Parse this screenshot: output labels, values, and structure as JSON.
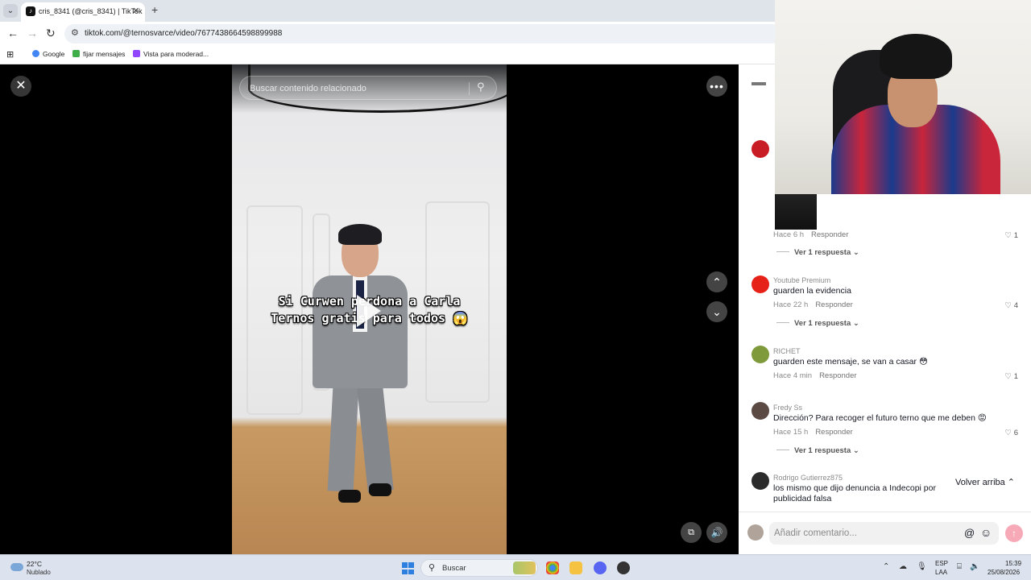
{
  "browser": {
    "tab_title": "cris_8341 (@cris_8341) | TikTok",
    "tab_close": "✕",
    "new_tab": "+",
    "url": "tiktok.com/@ternosvarce/video/7677438664598899988",
    "bookmarks": [
      {
        "label": "Google",
        "color": "#4285f4"
      },
      {
        "label": "fijar mensajes",
        "color": "#3fae49"
      },
      {
        "label": "Vista para moderad...",
        "color": "#9146ff"
      }
    ]
  },
  "video": {
    "search_placeholder": "Buscar contenido relacionado",
    "caption_line1": "Si Curwen perdona a Carla",
    "caption_line2": "Ternos gratis para todos 😱",
    "close_icon": "✕",
    "more_icon": "•••",
    "up_icon": "⌃",
    "down_icon": "⌄",
    "pip_icon": "⧉",
    "volume_icon": "🔊"
  },
  "comments": [
    {
      "user": "",
      "text": "",
      "time": "Hace 6 h",
      "reply": "Responder",
      "likes": "1",
      "replies_label": "Ver 1 respuesta",
      "avatar_color": "#c81d25"
    },
    {
      "user": "Youtube Premium",
      "text": "guarden la evidencia",
      "time": "Hace 22 h",
      "reply": "Responder",
      "likes": "4",
      "replies_label": "Ver 1 respuesta",
      "avatar_color": "#e62117"
    },
    {
      "user": "RICHET",
      "text": "guarden este mensaje, se van a casar 😳",
      "time": "Hace 4 min",
      "reply": "Responder",
      "likes": "1",
      "replies_label": "",
      "avatar_color": "#7e9a3a"
    },
    {
      "user": "Fredy Ss",
      "text": "Dirección? Para recoger el futuro terno que me deben 😡",
      "time": "Hace 15 h",
      "reply": "Responder",
      "likes": "6",
      "replies_label": "Ver 1 respuesta",
      "avatar_color": "#5b4a43"
    },
    {
      "user": "Rodrigo Gutierrez875",
      "text": "los mismo que dijo denuncia a Indecopi por publicidad falsa",
      "time": "",
      "reply": "",
      "likes": "",
      "replies_label": "",
      "avatar_color": "#2b2b2b"
    }
  ],
  "back_to_top": "Volver arriba ⌃",
  "comment_input": {
    "placeholder": "Añadir comentario...",
    "at_icon": "@",
    "emoji_icon": "☺",
    "send_icon": "↑"
  },
  "taskbar": {
    "temperature": "22°C",
    "condition": "Nublado",
    "search_label": "Buscar",
    "lang_top": "ESP",
    "lang_bottom": "LAA",
    "time": "15:39",
    "date": "25/08/2026"
  }
}
